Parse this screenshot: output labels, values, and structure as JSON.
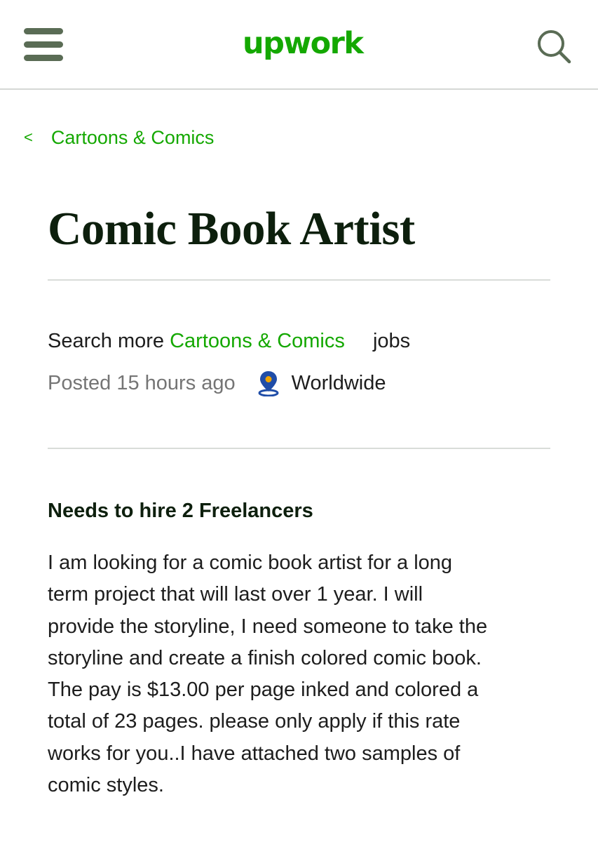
{
  "header": {
    "logo_text": "upwork",
    "menu_icon": "hamburger-menu-icon",
    "search_icon": "search-icon",
    "brand_color": "#14a800"
  },
  "breadcrumb": {
    "chevron": "<",
    "label": "Cartoons & Comics"
  },
  "job": {
    "title": "Comic Book Artist",
    "search_more_prefix": "Search more",
    "search_more_link": "Cartoons & Comics",
    "search_more_suffix": "jobs",
    "posted": "Posted 15 hours ago",
    "location_icon": "location-pin-icon",
    "location": "Worldwide",
    "hire_heading": "Needs to hire 2 Freelancers",
    "description": "I am looking for a comic book artist for a long\nterm project that will last over 1 year. I will\nprovide the storyline, I need someone to take the\nstoryline and create a finish colored comic book.\nThe pay is $13.00 per page inked and colored a\ntotal of 23 pages.  please only apply if this rate\nworks for you..I have attached two samples of\ncomic styles."
  }
}
